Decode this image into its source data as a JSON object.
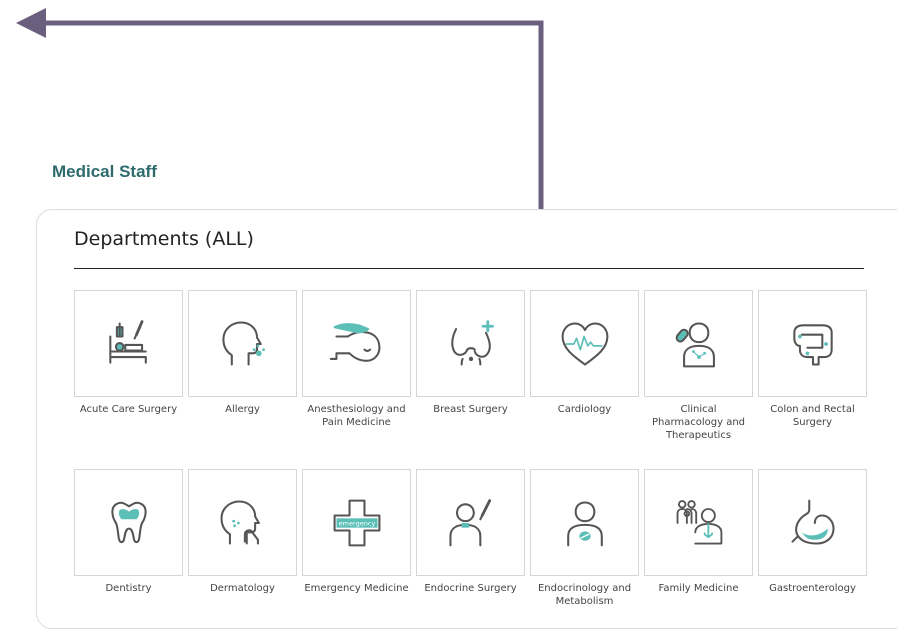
{
  "section": {
    "title": "Medical Staff"
  },
  "panel": {
    "title": "Departments (ALL)"
  },
  "departments": [
    {
      "label": "Acute Care Surgery",
      "icon": "hospital-bed-icon"
    },
    {
      "label": "Allergy",
      "icon": "head-sneeze-icon"
    },
    {
      "label": "Anesthesiology and Pain Medicine",
      "icon": "patient-mask-icon"
    },
    {
      "label": "Breast Surgery",
      "icon": "breast-icon"
    },
    {
      "label": "Cardiology",
      "icon": "heart-pulse-icon"
    },
    {
      "label": "Clinical Pharmacology and Therapeutics",
      "icon": "person-pill-icon"
    },
    {
      "label": "Colon and Rectal Surgery",
      "icon": "colon-icon"
    },
    {
      "label": "Dentistry",
      "icon": "tooth-icon"
    },
    {
      "label": "Dermatology",
      "icon": "face-skin-icon"
    },
    {
      "label": "Emergency Medicine",
      "icon": "emergency-cross-icon",
      "icon_text": "emergency"
    },
    {
      "label": "Endocrine Surgery",
      "icon": "thyroid-scalpel-icon"
    },
    {
      "label": "Endocrinology and Metabolism",
      "icon": "pancreas-body-icon"
    },
    {
      "label": "Family Medicine",
      "icon": "family-doctor-icon"
    },
    {
      "label": "Gastroenterology",
      "icon": "stomach-icon"
    }
  ],
  "colors": {
    "accent": "#2e6b6d",
    "icon_stroke": "#555555",
    "icon_fill": "#5bbfb8",
    "arrow": "#6b5f80"
  }
}
